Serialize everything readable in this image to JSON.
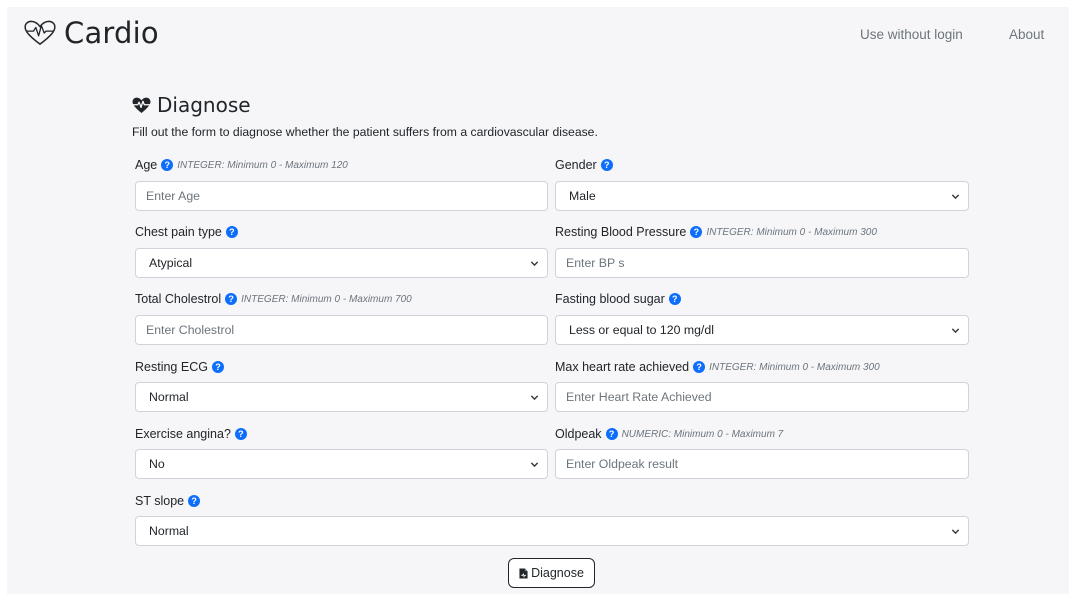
{
  "navbar": {
    "brand": "Cardio",
    "links": [
      "Use without login",
      "About"
    ]
  },
  "page": {
    "title": "Diagnose",
    "description": "Fill out the form to diagnose whether the patient suffers from a cardiovascular disease."
  },
  "fields": {
    "age": {
      "label": "Age",
      "hint": "INTEGER: Minimum 0 - Maximum 120",
      "placeholder": "Enter Age"
    },
    "gender": {
      "label": "Gender",
      "value": "Male"
    },
    "chest_pain": {
      "label": "Chest pain type",
      "value": "Atypical"
    },
    "resting_bp": {
      "label": "Resting Blood Pressure",
      "hint": "INTEGER: Minimum 0 - Maximum 300",
      "placeholder": "Enter BP s"
    },
    "cholesterol": {
      "label": "Total Cholestrol",
      "hint": "INTEGER: Minimum 0 - Maximum 700",
      "placeholder": "Enter Cholestrol"
    },
    "fasting_sugar": {
      "label": "Fasting blood sugar",
      "value": "Less or equal to 120 mg/dl"
    },
    "resting_ecg": {
      "label": "Resting ECG",
      "value": "Normal"
    },
    "max_hr": {
      "label": "Max heart rate achieved",
      "hint": "INTEGER: Minimum 0 - Maximum 300",
      "placeholder": "Enter Heart Rate Achieved"
    },
    "exercise_angina": {
      "label": "Exercise angina?",
      "value": "No"
    },
    "oldpeak": {
      "label": "Oldpeak",
      "hint": "NUMERIC: Minimum 0 - Maximum 7",
      "placeholder": "Enter Oldpeak result"
    },
    "st_slope": {
      "label": "ST slope",
      "value": "Normal"
    }
  },
  "help_icon_glyph": "?",
  "submit": {
    "label": "Diagnose"
  },
  "colors": {
    "accent": "#0d6efd",
    "panel": "#f6f6f9",
    "border": "#ced4da",
    "muted": "#6c757d"
  }
}
